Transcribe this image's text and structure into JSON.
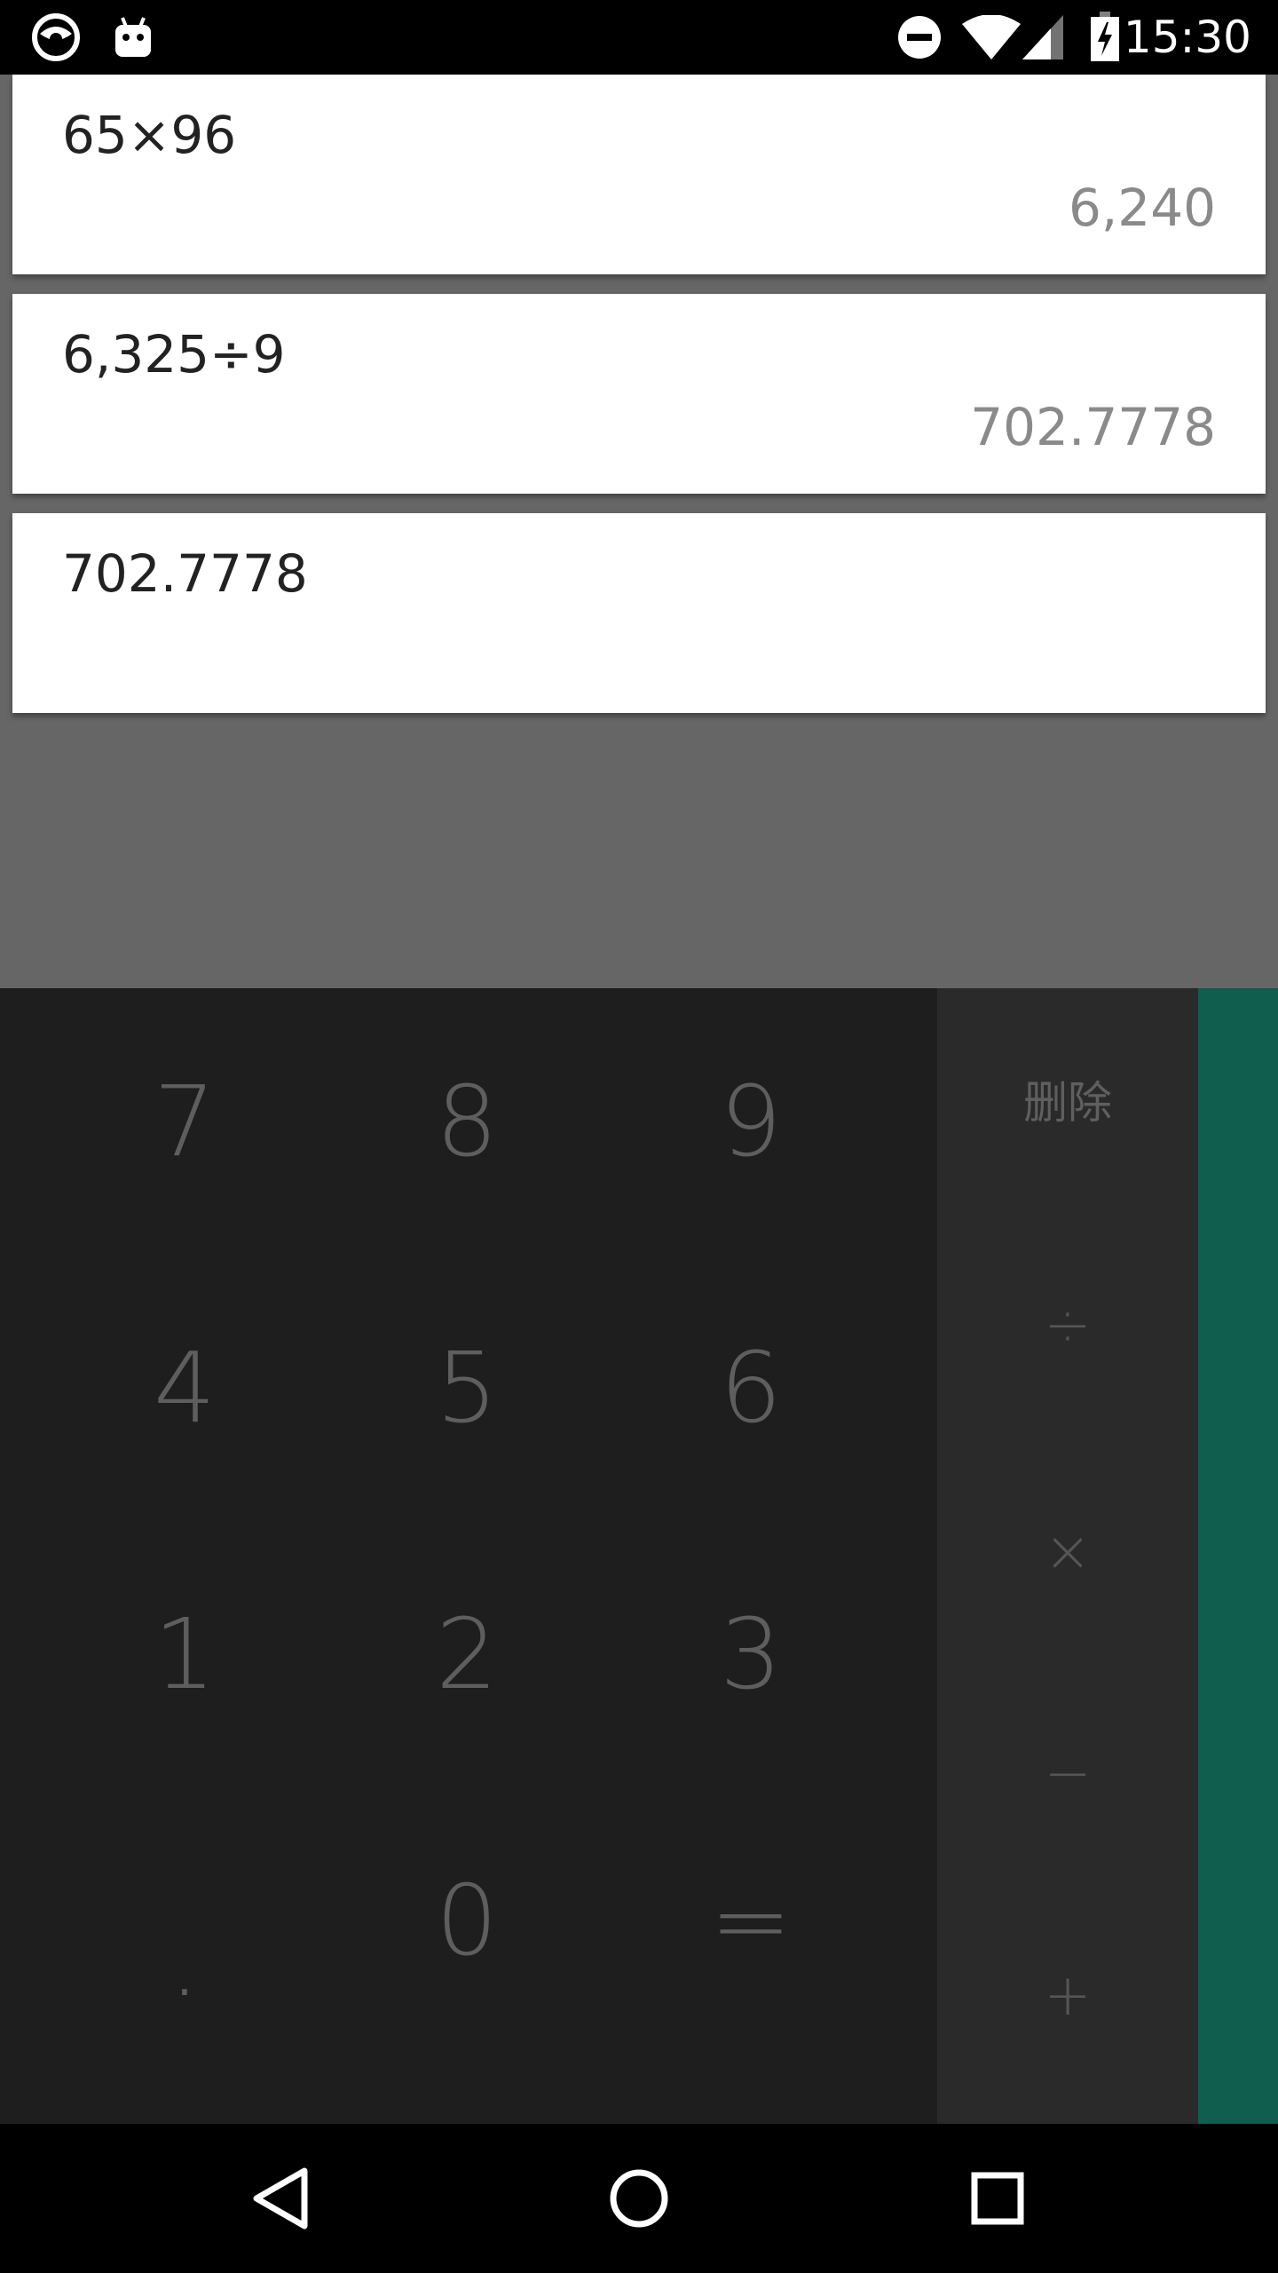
{
  "status_bar": {
    "time": "15:30",
    "icons": [
      "app-icon-1",
      "android-debug-icon",
      "do-not-disturb-icon",
      "wifi-icon",
      "cell-signal-icon",
      "battery-charging-icon"
    ]
  },
  "history": [
    {
      "expression": "65×96",
      "result": "6,240"
    },
    {
      "expression": "6,325÷9",
      "result": "702.7778"
    },
    {
      "expression": "702.7778",
      "result": ""
    }
  ],
  "keypad": {
    "digits": [
      "7",
      "8",
      "9",
      "4",
      "5",
      "6",
      "1",
      "2",
      "3",
      ".",
      "0",
      "="
    ],
    "operators": {
      "delete": "删除",
      "divide": "÷",
      "multiply": "×",
      "minus": "−",
      "plus": "+"
    }
  },
  "colors": {
    "status_bar": "#000000",
    "history_bg": "#666666",
    "card": "#ffffff",
    "numpad": "#1e1e1e",
    "oppad": "#2a2a2a",
    "advanced_panel": "#0f5e4e",
    "nav_bar": "#000000"
  },
  "nav": {
    "icons": [
      "back-icon",
      "home-icon",
      "recents-icon"
    ]
  }
}
